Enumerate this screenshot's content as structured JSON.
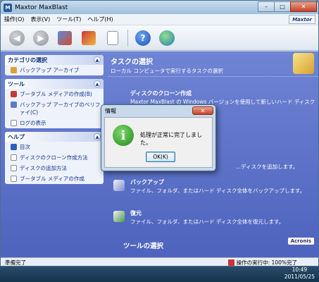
{
  "window": {
    "title": "Maxtor  MaxBlast",
    "brand": "Maxtor",
    "controls": {
      "minimize": "–",
      "maximize": "□",
      "close": "✕"
    }
  },
  "menu": [
    "操作(O)",
    "表示(V)",
    "ツール(T)",
    "ヘルプ(H)"
  ],
  "toolbar": {
    "buttons": [
      {
        "name": "back",
        "icon": "back-arrow-icon",
        "glyph": "◀"
      },
      {
        "name": "forward",
        "icon": "forward-arrow-icon",
        "glyph": "▶"
      },
      {
        "name": "backup",
        "icon": "backup-icon"
      },
      {
        "name": "tools",
        "icon": "tools-icon"
      },
      {
        "name": "log",
        "icon": "document-icon"
      },
      {
        "name": "help",
        "icon": "help-icon",
        "glyph": "?"
      },
      {
        "name": "update",
        "icon": "update-globe-icon"
      }
    ]
  },
  "sidebar": {
    "panels": [
      {
        "title": "カテゴリの選択",
        "items": [
          "バックアップ アーカイブ"
        ]
      },
      {
        "title": "ツール",
        "items": [
          "ブータブル メディアの作成(B)",
          "バックアップ アーカイブのベリファイ(C)",
          "ログの表示"
        ]
      },
      {
        "title": "ヘルプ",
        "items": [
          "目次",
          "ディスクのクローン作成方法",
          "ディスクの追加方法",
          "ブータブル メディアの作成"
        ]
      }
    ]
  },
  "main": {
    "heading": "タスクの選択",
    "subheading": "ローカル コンピュータで実行するタスクの選択",
    "tasks": [
      {
        "title": "ディスクのクローン作成",
        "desc": "Maxtor MaxBlast の Windows バージョンを使用して新しいハード ディスクを..."
      },
      {
        "title": "",
        "desc": "...ディスクを追加します。"
      },
      {
        "title": "バックアップ",
        "desc": "ファイル、フォルダ、またはハード ディスク全体をバックアップします。"
      },
      {
        "title": "復元",
        "desc": "ファイル、フォルダ、またはハード ディスク全体を復元します。"
      }
    ],
    "tools_heading": "ツールの選択",
    "powered_by": "Acronis"
  },
  "status": {
    "left": "準備完了",
    "right": "操作の実行中: 100%完了"
  },
  "taskbar": {
    "time": "10:49",
    "date": "2011/05/25"
  },
  "dialog": {
    "title": "情報",
    "close": "✕",
    "icon_glyph": "i",
    "message": "処理が正常に完了しました。",
    "ok_label": "OK(K)"
  }
}
